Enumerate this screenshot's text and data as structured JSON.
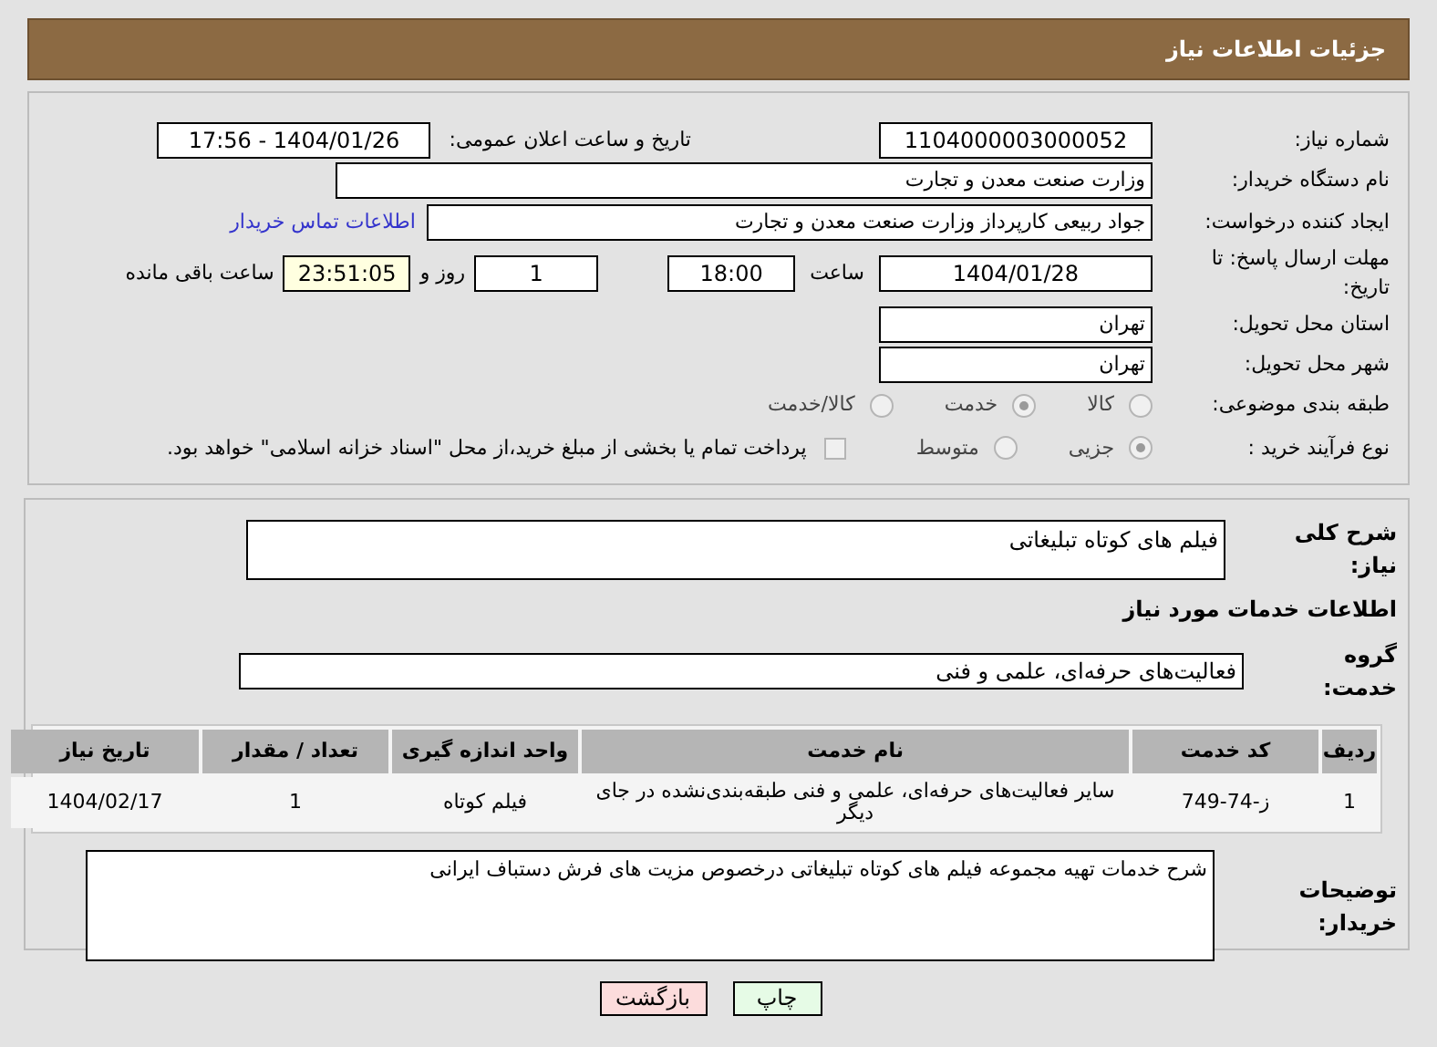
{
  "header": {
    "title": "جزئیات اطلاعات نیاز"
  },
  "need_number": {
    "label": "شماره نیاز:",
    "value": "1104000003000052"
  },
  "announce": {
    "label": "تاریخ و ساعت اعلان عمومی:",
    "value": "1404/01/26 - 17:56"
  },
  "buyer_org": {
    "label": "نام دستگاه خریدار:",
    "value": "وزارت صنعت معدن و تجارت"
  },
  "requester": {
    "label": "ایجاد کننده درخواست:",
    "value": "جواد ربیعی کارپرداز وزارت صنعت معدن و تجارت",
    "link": "اطلاعات تماس خریدار"
  },
  "deadline": {
    "label": "مهلت ارسال پاسخ: تا تاریخ:",
    "date": "1404/01/28",
    "time_label": "ساعت",
    "time": "18:00",
    "days": "1",
    "days_label": "روز و",
    "remaining": "23:51:05",
    "remaining_label": "ساعت باقی مانده"
  },
  "province": {
    "label": "استان محل تحویل:",
    "value": "تهران"
  },
  "city": {
    "label": "شهر محل تحویل:",
    "value": "تهران"
  },
  "category": {
    "label": "طبقه بندی موضوعی:",
    "options": [
      {
        "label": "کالا",
        "selected": false
      },
      {
        "label": "خدمت",
        "selected": true
      },
      {
        "label": "کالا/خدمت",
        "selected": false
      }
    ]
  },
  "process": {
    "label": "نوع فرآیند خرید :",
    "options": [
      {
        "label": "جزیی",
        "selected": true
      },
      {
        "label": "متوسط",
        "selected": false
      }
    ],
    "payment": {
      "checked": false,
      "text": "پرداخت تمام یا بخشی از مبلغ خرید،از محل \"اسناد خزانه اسلامی\" خواهد بود."
    }
  },
  "description": {
    "label": "شرح کلی نیاز:",
    "value": "فیلم های کوتاه تبلیغاتی"
  },
  "services_heading": "اطلاعات خدمات مورد نیاز",
  "service_group": {
    "label": "گروه خدمت:",
    "value": "فعالیت‌های حرفه‌ای، علمی و فنی"
  },
  "table": {
    "columns": [
      "ردیف",
      "کد خدمت",
      "نام خدمت",
      "واحد اندازه گیری",
      "تعداد / مقدار",
      "تاریخ نیاز"
    ],
    "rows": [
      [
        "1",
        "ز-74-749",
        "سایر فعالیت‌های حرفه‌ای، علمی و فنی طبقه‌بندی‌نشده در جای دیگر",
        "فیلم کوتاه",
        "1",
        "1404/02/17"
      ]
    ]
  },
  "buyer_notes": {
    "label": "توضیحات خریدار:",
    "value": "شرح خدمات تهیه مجموعه فیلم های کوتاه تبلیغاتی درخصوص مزیت های فرش دستباف ایرانی"
  },
  "buttons": [
    {
      "kind": "print",
      "label": "چاپ"
    },
    {
      "kind": "back",
      "label": "بازگشت"
    }
  ]
}
